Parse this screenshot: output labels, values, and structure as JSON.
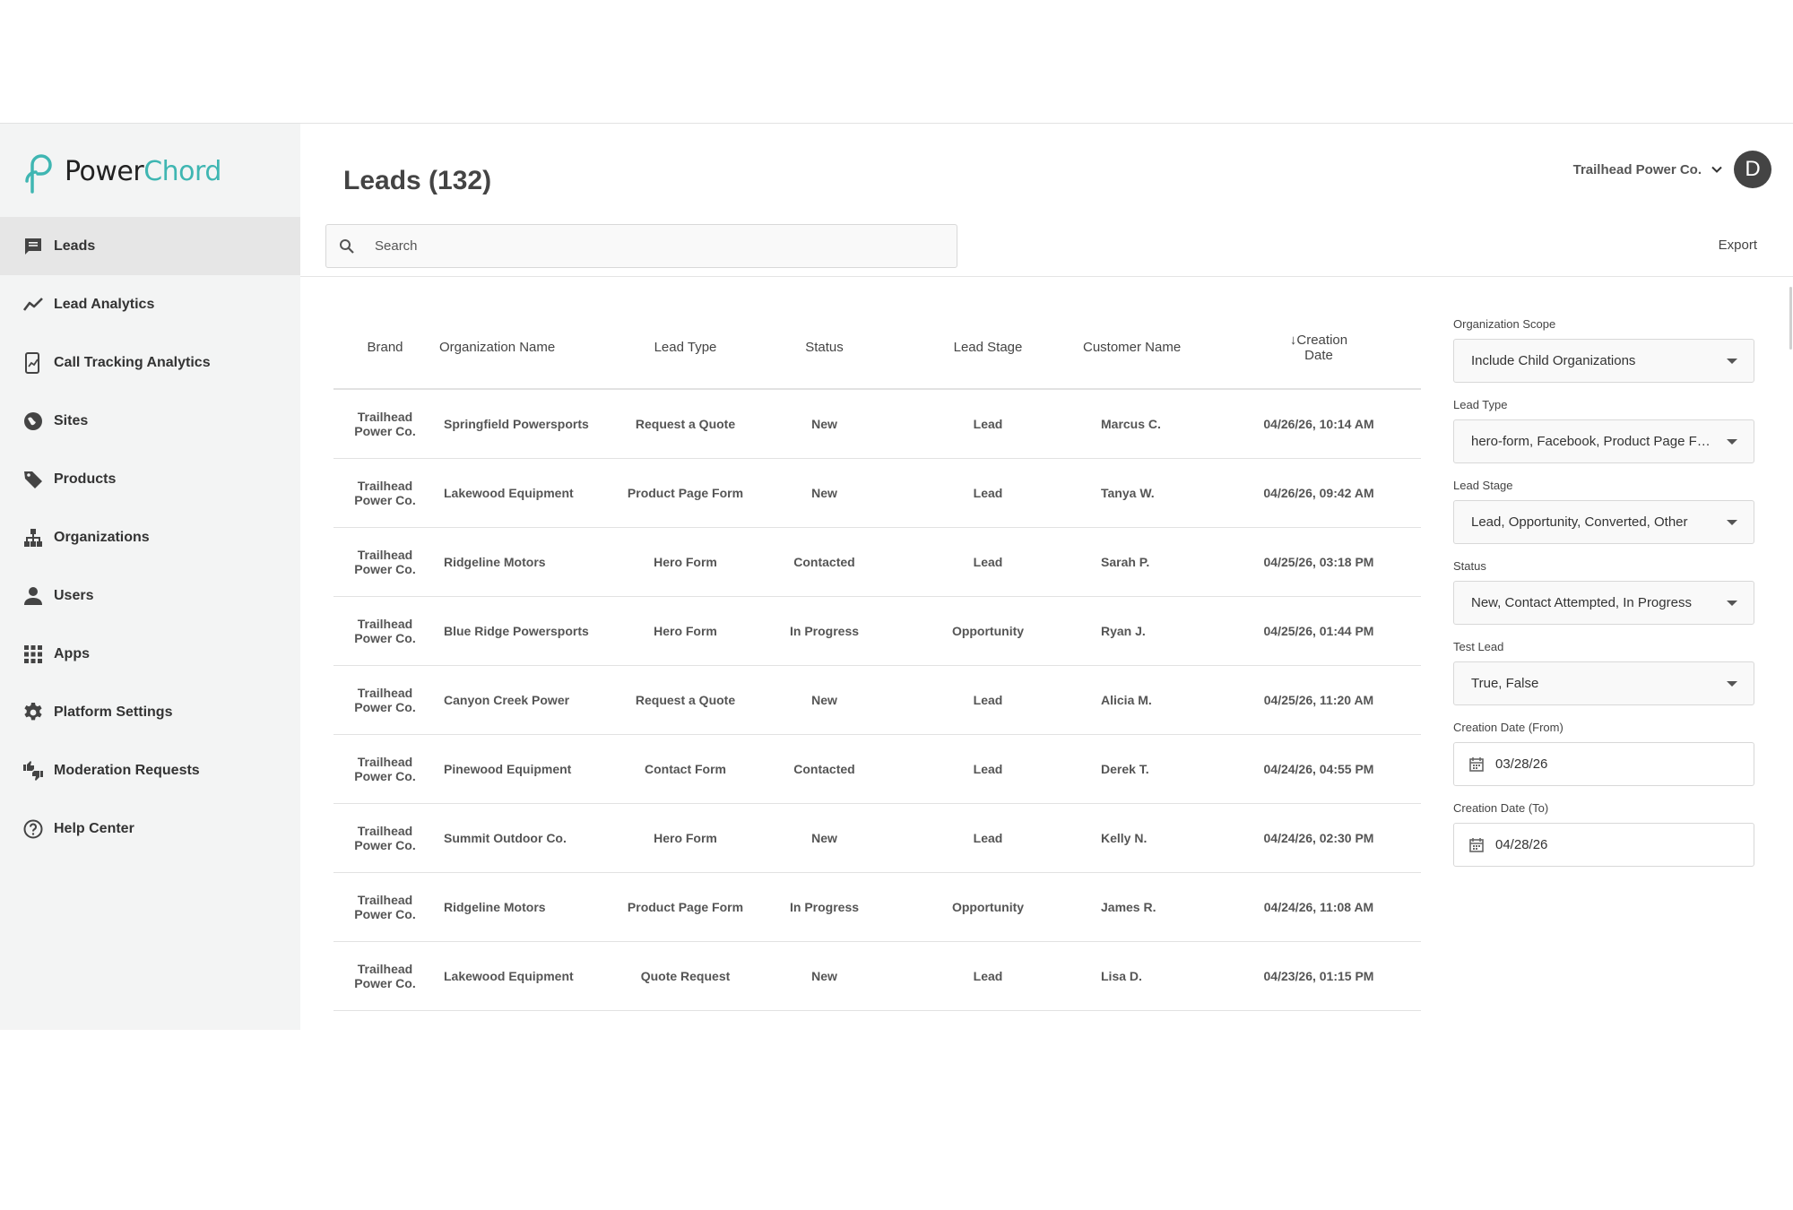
{
  "brand": {
    "logo_part1": "Power",
    "logo_part2": "Chord"
  },
  "sidebar": {
    "items": [
      {
        "label": "Leads",
        "icon": "chat-icon",
        "active": true
      },
      {
        "label": "Lead Analytics",
        "icon": "trend-icon"
      },
      {
        "label": "Call Tracking Analytics",
        "icon": "phone-chart-icon"
      },
      {
        "label": "Sites",
        "icon": "globe-icon"
      },
      {
        "label": "Products",
        "icon": "tag-icon"
      },
      {
        "label": "Organizations",
        "icon": "org-chart-icon"
      },
      {
        "label": "Users",
        "icon": "user-icon"
      },
      {
        "label": "Apps",
        "icon": "grid-icon"
      },
      {
        "label": "Platform Settings",
        "icon": "gear-icon"
      },
      {
        "label": "Moderation Requests",
        "icon": "thumbs-icon"
      },
      {
        "label": "Help Center",
        "icon": "help-icon"
      }
    ]
  },
  "header": {
    "title": "Leads (132)",
    "account_name": "Trailhead Power Co.",
    "avatar_initial": "D",
    "search_placeholder": "Search",
    "export_label": "Export"
  },
  "table": {
    "columns": {
      "brand": "Brand",
      "org": "Organization Name",
      "type": "Lead Type",
      "status": "Status",
      "stage": "Lead Stage",
      "customer": "Customer Name",
      "sort_arrow": "↓",
      "date_line1": "Creation",
      "date_line2": "Date"
    },
    "rows": [
      {
        "brand1": "Trailhead",
        "brand2": "Power Co.",
        "org": "Springfield Powersports",
        "type": "Request a Quote",
        "status": "New",
        "stage": "Lead",
        "customer": "Marcus C.",
        "date": "04/26/26, 10:14 AM"
      },
      {
        "brand1": "Trailhead",
        "brand2": "Power Co.",
        "org": "Lakewood Equipment",
        "type": "Product Page Form",
        "status": "New",
        "stage": "Lead",
        "customer": "Tanya W.",
        "date": "04/26/26, 09:42 AM"
      },
      {
        "brand1": "Trailhead",
        "brand2": "Power Co.",
        "org": "Ridgeline Motors",
        "type": "Hero Form",
        "status": "Contacted",
        "stage": "Lead",
        "customer": "Sarah P.",
        "date": "04/25/26, 03:18 PM"
      },
      {
        "brand1": "Trailhead",
        "brand2": "Power Co.",
        "org": "Blue Ridge Powersports",
        "type": "Hero Form",
        "status": "In Progress",
        "stage": "Opportunity",
        "customer": "Ryan J.",
        "date": "04/25/26, 01:44 PM"
      },
      {
        "brand1": "Trailhead",
        "brand2": "Power Co.",
        "org": "Canyon Creek Power",
        "type": "Request a Quote",
        "status": "New",
        "stage": "Lead",
        "customer": "Alicia M.",
        "date": "04/25/26, 11:20 AM"
      },
      {
        "brand1": "Trailhead",
        "brand2": "Power Co.",
        "org": "Pinewood Equipment",
        "type": "Contact Form",
        "status": "Contacted",
        "stage": "Lead",
        "customer": "Derek T.",
        "date": "04/24/26, 04:55 PM"
      },
      {
        "brand1": "Trailhead",
        "brand2": "Power Co.",
        "org": "Summit Outdoor Co.",
        "type": "Hero Form",
        "status": "New",
        "stage": "Lead",
        "customer": "Kelly N.",
        "date": "04/24/26, 02:30 PM"
      },
      {
        "brand1": "Trailhead",
        "brand2": "Power Co.",
        "org": "Ridgeline Motors",
        "type": "Product Page Form",
        "status": "In Progress",
        "stage": "Opportunity",
        "customer": "James R.",
        "date": "04/24/26, 11:08 AM"
      },
      {
        "brand1": "Trailhead",
        "brand2": "Power Co.",
        "org": "Lakewood Equipment",
        "type": "Quote Request",
        "status": "New",
        "stage": "Lead",
        "customer": "Lisa D.",
        "date": "04/23/26, 01:15 PM"
      }
    ]
  },
  "filters": {
    "org_scope": {
      "label": "Organization Scope",
      "value": "Include Child Organizations"
    },
    "lead_type": {
      "label": "Lead Type",
      "value": "hero-form, Facebook, Product Page Form"
    },
    "lead_stage": {
      "label": "Lead Stage",
      "value": "Lead, Opportunity, Converted, Other"
    },
    "status": {
      "label": "Status",
      "value": "New, Contact Attempted, In Progress"
    },
    "test_lead": {
      "label": "Test Lead",
      "value": "True, False"
    },
    "date_from": {
      "label": "Creation Date (From)",
      "value": "03/28/26"
    },
    "date_to": {
      "label": "Creation Date (To)",
      "value": "04/28/26"
    }
  }
}
